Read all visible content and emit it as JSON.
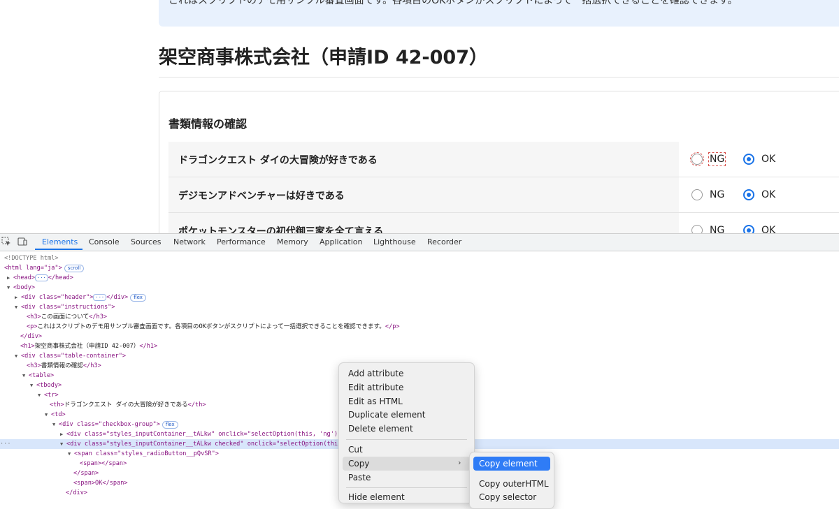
{
  "page": {
    "instructions_text": "これはスクリプトのデモ用サンプル審査画面です。各項目のOKボタンがスクリプトによって一括選択できることを確認できます。",
    "title": "架空商事株式会社（申請ID 42-007）",
    "section_title": "書類情報の確認",
    "rows": [
      {
        "question": "ドラゴンクエスト ダイの大冒険が好きである",
        "ng_label": "NG",
        "ok_label": "OK",
        "selected": "OK"
      },
      {
        "question": "デジモンアドベンチャーは好きである",
        "ng_label": "NG",
        "ok_label": "OK",
        "selected": "OK"
      },
      {
        "question": "ポケットモンスターの初代御三家を全て言える",
        "ng_label": "NG",
        "ok_label": "OK",
        "selected": "OK"
      }
    ]
  },
  "devtools": {
    "tabs": [
      "Elements",
      "Console",
      "Sources",
      "Network",
      "Performance",
      "Memory",
      "Application",
      "Lighthouse",
      "Recorder"
    ],
    "active_tab": "Elements",
    "dom": {
      "doctype": "<!DOCTYPE html>",
      "html_open": "<html lang=\"ja\">",
      "scroll_badge": "scroll",
      "head": "<head>",
      "head_close": "</head>",
      "body_open": "<body>",
      "header_div": "<div class=\"header\">",
      "div_close": "</div>",
      "flex_badge": "flex",
      "instructions_div": "<div class=\"instructions\">",
      "h3_about_open": "<h3>",
      "h3_about_text": "この画面について",
      "h3_close": "</h3>",
      "p_open": "<p>",
      "p_text": "これはスクリプトのデモ用サンプル審査画面です。各項目のOKボタンがスクリプトによって一括選択できることを確認できます。",
      "p_close": "</p>",
      "h1_open": "<h1>",
      "h1_text": "架空商事株式会社（申請ID 42-007）",
      "h1_close": "</h1>",
      "table_container_div": "<div class=\"table-container\">",
      "h3_section_text": "書類情報の確認",
      "table_open": "<table>",
      "tbody_open": "<tbody>",
      "tr_open": "<tr>",
      "th_open": "<th>",
      "th_text": "ドラゴンクエスト ダイの大冒険が好きである",
      "th_close": "</th>",
      "td_open": "<td>",
      "checkbox_group_div": "<div class=\"checkbox-group\">",
      "input_container_ng": "<div class=\"styles_inputContainer__tALkw\" onclick=\"selectOption(this, 'ng')\">",
      "input_container_checked": "<div class=\"styles_inputContainer__tALkw checked\" onclick=\"selectOption(this, '",
      "radio_span": "<span class=\"styles_radioButton__pQvSR\">",
      "inner_span": "<span></span>",
      "span_close": "</span>",
      "ok_span": "<span>OK</span>",
      "ellipsis": "···",
      "gutter_dots": "···"
    }
  },
  "context_menu": {
    "items": [
      "Add attribute",
      "Edit attribute",
      "Edit as HTML",
      "Duplicate element",
      "Delete element",
      "Cut",
      "Copy",
      "Paste",
      "Hide element"
    ],
    "highlighted": "Copy",
    "submenu": [
      "Copy element",
      "Copy outerHTML",
      "Copy selector"
    ],
    "submenu_highlighted": "Copy element"
  },
  "colors": {
    "accent": "#1a73e8",
    "selected_row": "#d8e6fb",
    "instructions_bg": "#e8f1fd",
    "menu_highlight": "#2f7cf6"
  }
}
